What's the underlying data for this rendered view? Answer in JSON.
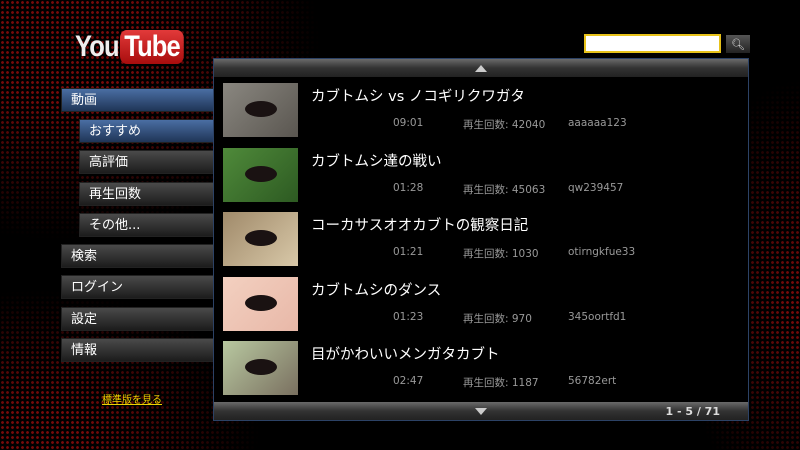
{
  "logo": {
    "text_you": "You",
    "text_tube": "Tube"
  },
  "menu": {
    "videos": "動画",
    "sub": [
      "おすすめ",
      "高評価",
      "再生回数",
      "その他..."
    ],
    "search": "検索",
    "login": "ログイン",
    "settings": "設定",
    "info": "情報"
  },
  "standard_link": "標準版を見る",
  "search": {
    "value": "",
    "icon": "search-icon"
  },
  "pagination": "1 - 5 / 71",
  "videos": [
    {
      "title": "カブトムシ vs ノコギリクワガタ",
      "duration": "09:01",
      "views": "再生回数: 42040",
      "user": "aaaaaa123",
      "thumb_colors": [
        "#8a8780",
        "#5a5650"
      ]
    },
    {
      "title": "カブトムシ達の戦い",
      "duration": "01:28",
      "views": "再生回数: 45063",
      "user": "qw239457",
      "thumb_colors": [
        "#4f8a3a",
        "#2d5a22"
      ]
    },
    {
      "title": "コーカサスオオカブトの観察日記",
      "duration": "01:21",
      "views": "再生回数: 1030",
      "user": "otirngkfue33",
      "thumb_colors": [
        "#a08a6a",
        "#d8c8a8"
      ]
    },
    {
      "title": "カブトムシのダンス",
      "duration": "01:23",
      "views": "再生回数: 970",
      "user": "345oortfd1",
      "thumb_colors": [
        "#f3d0c0",
        "#e8b8a8"
      ]
    },
    {
      "title": "目がかわいいメンガタカブト",
      "duration": "02:47",
      "views": "再生回数: 1187",
      "user": "56782ert",
      "thumb_colors": [
        "#b8c8a0",
        "#7a7060"
      ]
    }
  ]
}
